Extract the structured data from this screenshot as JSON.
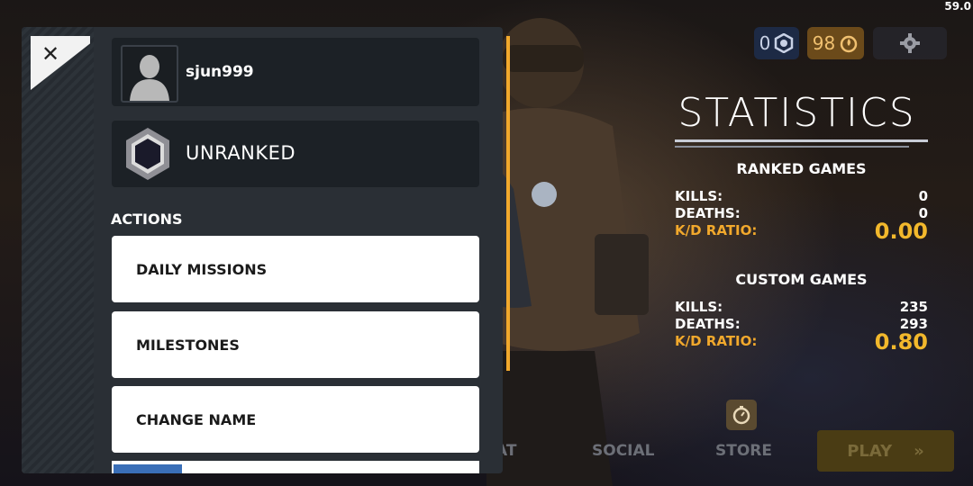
{
  "fps": "59.0",
  "currency": {
    "credits": "0",
    "coins": "98"
  },
  "statistics": {
    "title": "STATISTICS",
    "ranked": {
      "heading": "RANKED GAMES",
      "kills_label": "KILLS:",
      "kills": "0",
      "deaths_label": "DEATHS:",
      "deaths": "0",
      "kd_label": "K/D RATIO:",
      "kd": "0.00"
    },
    "custom": {
      "heading": "CUSTOM GAMES",
      "kills_label": "KILLS:",
      "kills": "235",
      "deaths_label": "DEATHS:",
      "deaths": "293",
      "kd_label": "K/D RATIO:",
      "kd": "0.80"
    }
  },
  "nav": {
    "left_partial": "AT",
    "social": "SOCIAL",
    "store": "STORE",
    "play": "PLAY"
  },
  "profile": {
    "close_glyph": "✕",
    "username": "sjun999",
    "rank": "UNRANKED",
    "actions_heading": "ACTIONS",
    "actions": [
      "DAILY MISSIONS",
      "MILESTONES",
      "CHANGE NAME"
    ]
  },
  "colors": {
    "accent": "#f2a92c",
    "panel": "#2a2f35",
    "card": "#1c2126"
  },
  "icons": [
    "close-icon",
    "avatar-icon",
    "rank-icon",
    "credits-icon",
    "coins-icon",
    "gear-icon",
    "store-timer-icon",
    "chevron-right-icon"
  ]
}
